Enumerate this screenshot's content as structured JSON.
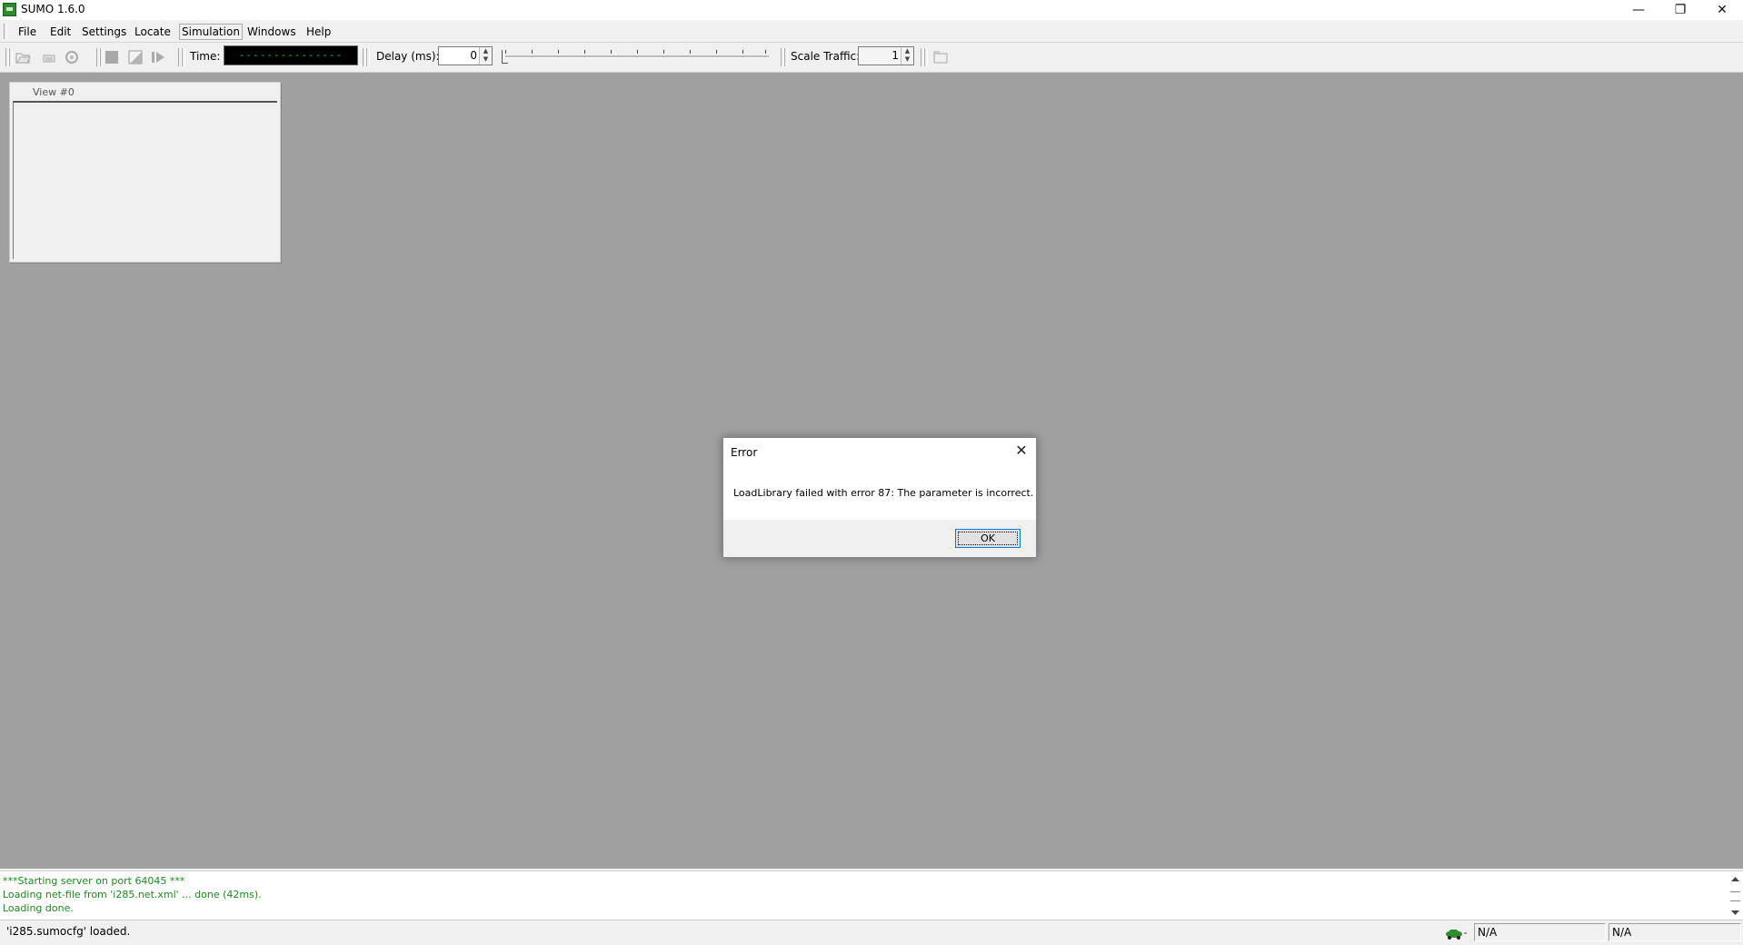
{
  "window": {
    "title": "SUMO 1.6.0",
    "minimize": "—",
    "restore": "❐",
    "close": "✕"
  },
  "menubar": {
    "items": [
      "File",
      "Edit",
      "Settings",
      "Locate",
      "Simulation",
      "Windows",
      "Help"
    ]
  },
  "toolbar": {
    "time_label": "Time:",
    "time_display": "---------------",
    "delay_label": "Delay (ms):",
    "delay_value": "0",
    "scale_traffic_label": "Scale Traffic:",
    "scale_traffic_value": "1",
    "spin_up": "▲",
    "spin_down": "▼"
  },
  "view": {
    "title": "View #0"
  },
  "dialog": {
    "title": "Error",
    "close": "✕",
    "message": "LoadLibrary failed with error 87: The parameter is incorrect.",
    "ok_label": "OK"
  },
  "log": {
    "lines": [
      "***Starting server on port 64045 ***",
      "Loading net-file from 'i285.net.xml' ... done (42ms).",
      "Loading done."
    ]
  },
  "statusbar": {
    "message": "'i285.sumocfg' loaded.",
    "panel1": "N/A",
    "panel2": "N/A"
  },
  "colors": {
    "mdi_background": "#a0a0a0",
    "log_text": "#1a8a1a",
    "time_display_text": "#1fd41f"
  }
}
